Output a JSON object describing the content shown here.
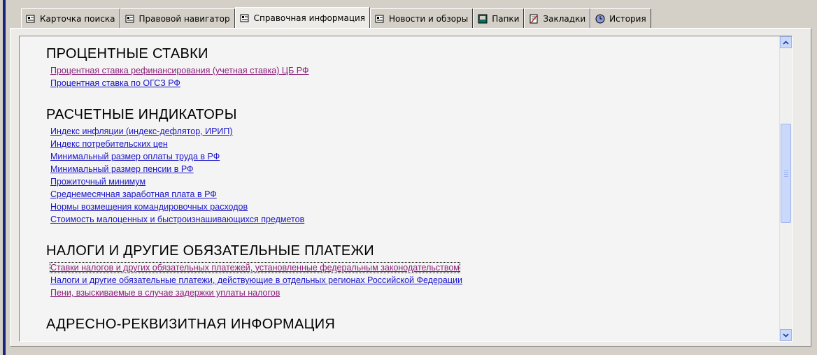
{
  "tabs": [
    {
      "label": "Карточка поиска",
      "icon": "card-icon"
    },
    {
      "label": "Правовой навигатор",
      "icon": "navigator-icon"
    },
    {
      "label": "Справочная информация",
      "icon": "reference-icon",
      "active": true
    },
    {
      "label": "Новости и обзоры",
      "icon": "news-icon"
    },
    {
      "label": "Папки",
      "icon": "folder-icon"
    },
    {
      "label": "Закладки",
      "icon": "bookmark-icon"
    },
    {
      "label": "История",
      "icon": "history-icon"
    }
  ],
  "sections": [
    {
      "title": "ПРОЦЕНТНЫЕ СТАВКИ",
      "links": [
        "Процентная ставка рефинансирования (учетная ставка) ЦБ РФ",
        "Процентная ставка по ОГСЗ РФ"
      ]
    },
    {
      "title": "РАСЧЕТНЫЕ ИНДИКАТОРЫ",
      "links": [
        "Индекс инфляции (индекс-дефлятор, ИРИП)",
        "Индекс потребительских цен",
        "Минимальный размер оплаты труда в РФ",
        "Минимальный размер пенсии в РФ",
        "Прожиточный минимум",
        "Среднемесячная заработная плата в РФ",
        "Нормы возмещения командировочных расходов",
        "Стоимость малоценных и быстроизнашивающихся предметов"
      ]
    },
    {
      "title": "НАЛОГИ И ДРУГИЕ ОБЯЗАТЕЛЬНЫЕ ПЛАТЕЖИ",
      "links": [
        "Ставки налогов и других обязательных платежей, установленные федеральным законодательством",
        "Налоги и другие обязательные платежи, действующие в отдельных регионах Российской Федерации",
        "Пени, взыскиваемые в случае задержки уплаты налогов"
      ]
    },
    {
      "title": "АДРЕСНО-РЕКВИЗИТНАЯ ИНФОРМАЦИЯ",
      "links": []
    }
  ],
  "colors": {
    "link": "#1a14c8",
    "visited_link": "#8a1f7a",
    "scrollbar": "#c9d8fb"
  }
}
